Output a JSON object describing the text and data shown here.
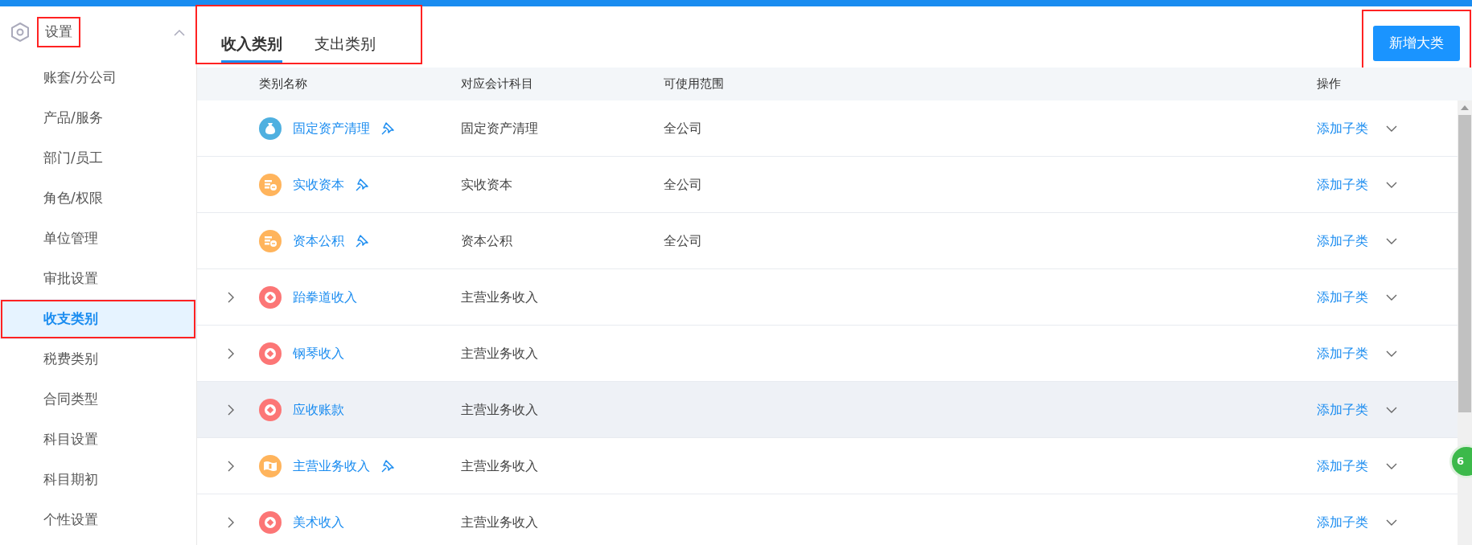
{
  "sidebar": {
    "title": "设置",
    "expanded": true,
    "annotated": true,
    "items": [
      {
        "label": "账套/分公司",
        "selected": false,
        "annotated": false
      },
      {
        "label": "产品/服务",
        "selected": false,
        "annotated": false
      },
      {
        "label": "部门/员工",
        "selected": false,
        "annotated": false
      },
      {
        "label": "角色/权限",
        "selected": false,
        "annotated": false
      },
      {
        "label": "单位管理",
        "selected": false,
        "annotated": false
      },
      {
        "label": "审批设置",
        "selected": false,
        "annotated": false
      },
      {
        "label": "收支类别",
        "selected": true,
        "annotated": true
      },
      {
        "label": "税费类别",
        "selected": false,
        "annotated": false
      },
      {
        "label": "合同类型",
        "selected": false,
        "annotated": false
      },
      {
        "label": "科目设置",
        "selected": false,
        "annotated": false
      },
      {
        "label": "科目期初",
        "selected": false,
        "annotated": false
      },
      {
        "label": "个性设置",
        "selected": false,
        "annotated": false
      }
    ]
  },
  "tabs": {
    "annotated": true,
    "items": [
      {
        "label": "收入类别",
        "selected": true
      },
      {
        "label": "支出类别",
        "selected": false
      }
    ]
  },
  "add_button": {
    "label": "新增大类",
    "annotated": true
  },
  "table": {
    "columns": [
      "类别名称",
      "对应会计科目",
      "可使用范围",
      "操作"
    ],
    "rows": [
      {
        "name": "固定资产清理",
        "account": "固定资产清理",
        "scope": "全公司",
        "action": "添加子类",
        "kind": "moneybag",
        "color": "#4fb0e0",
        "pinned": true,
        "expandable": false,
        "hovered": false
      },
      {
        "name": "实收资本",
        "account": "实收资本",
        "scope": "全公司",
        "action": "添加子类",
        "kind": "coins",
        "color": "#ffb45c",
        "pinned": true,
        "expandable": false,
        "hovered": false
      },
      {
        "name": "资本公积",
        "account": "资本公积",
        "scope": "全公司",
        "action": "添加子类",
        "kind": "coins",
        "color": "#ffb45c",
        "pinned": true,
        "expandable": false,
        "hovered": false
      },
      {
        "name": "跆拳道收入",
        "account": "主营业务收入",
        "action": "添加子类",
        "kind": "diamond",
        "color": "#fc7676",
        "pinned": false,
        "expandable": true,
        "hovered": false
      },
      {
        "name": "钢琴收入",
        "account": "主营业务收入",
        "action": "添加子类",
        "kind": "diamond",
        "color": "#fc7676",
        "pinned": false,
        "expandable": true,
        "hovered": false
      },
      {
        "name": "应收账款",
        "account": "主营业务收入",
        "action": "添加子类",
        "kind": "diamond",
        "color": "#fc7676",
        "pinned": false,
        "expandable": true,
        "hovered": true
      },
      {
        "name": "主营业务收入",
        "account": "主营业务收入",
        "action": "添加子类",
        "kind": "banknote",
        "color": "#ffb45c",
        "pinned": true,
        "expandable": true,
        "hovered": false
      },
      {
        "name": "美术收入",
        "account": "主营业务收入",
        "action": "添加子类",
        "kind": "diamond",
        "color": "#fc7676",
        "pinned": false,
        "expandable": true,
        "hovered": false
      }
    ]
  },
  "floating_badge": {
    "label": "6"
  }
}
